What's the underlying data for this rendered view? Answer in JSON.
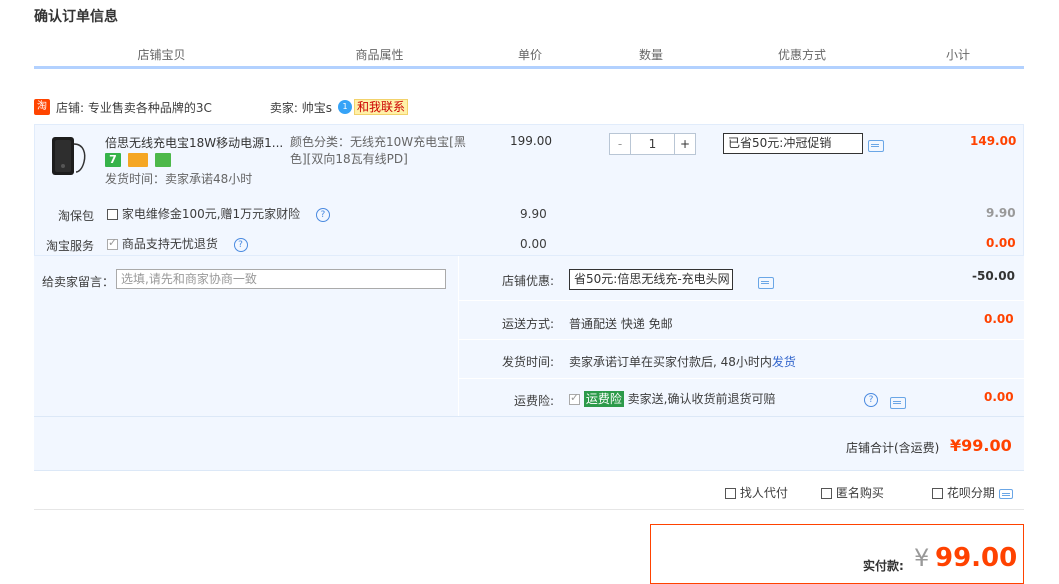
{
  "page": {
    "title": "确认订单信息"
  },
  "table_header": [
    "店铺宝贝",
    "商品属性",
    "单价",
    "数量",
    "优惠方式",
    "小计"
  ],
  "shop": {
    "badge": "淘",
    "name": "店铺: 专业售卖各种品牌的3C",
    "seller": "卖家: 帅宝s",
    "contact_label": "和我联系"
  },
  "item": {
    "title": "倍思无线充电宝18W移动电源1...",
    "shipping_time": "发货时间：卖家承诺48小时",
    "attr": "颜色分类：无线充10W充电宝[黑色][双向18瓦有线PD]",
    "unit_price": "199.00",
    "quantity": "1",
    "minus": "-",
    "plus": "+",
    "discount_select": "已省50元:冲冠促销",
    "subtotal": "149.00"
  },
  "taobaobao": {
    "label": "淘保包",
    "option": "家电维修金100元,赠1万元家财险",
    "price": "9.90",
    "subtotal": "9.90"
  },
  "service": {
    "label": "淘宝服务",
    "option": "商品支持无忧退货",
    "price": "0.00",
    "subtotal": "0.00"
  },
  "message": {
    "label": "给卖家留言：",
    "placeholder": "选填,请先和商家协商一致"
  },
  "shop_discount": {
    "label": "店铺优惠:",
    "value": "省50元:倍思无线充-充电头网",
    "amount": "-50.00"
  },
  "shipping": {
    "label": "运送方式:",
    "value": "普通配送 快递 免邮",
    "amount": "0.00"
  },
  "dispatch": {
    "label": "发货时间:",
    "value": "卖家承诺订单在买家付款后, 48小时内",
    "link": "发货"
  },
  "insurance": {
    "label": "运费险:",
    "tag": "运费险",
    "value": "卖家送,确认收货前退货可赔",
    "amount": "0.00"
  },
  "shop_total": {
    "label": "店铺合计(含运费)",
    "amount": "¥99.00"
  },
  "options": {
    "proxy_pay": "找人代付",
    "anonymous": "匿名购买",
    "huabei": "花呗分期"
  },
  "payment": {
    "label": "实付款:",
    "currency": "¥",
    "amount": "99.00"
  },
  "colors": {
    "accent": "#ff4200",
    "header_line": "#b2d1ff",
    "panel": "#f2f7ff"
  },
  "icons": [
    "message-icon",
    "help-icon",
    "wangwang-icon",
    "product-image",
    "tmall-badge"
  ]
}
